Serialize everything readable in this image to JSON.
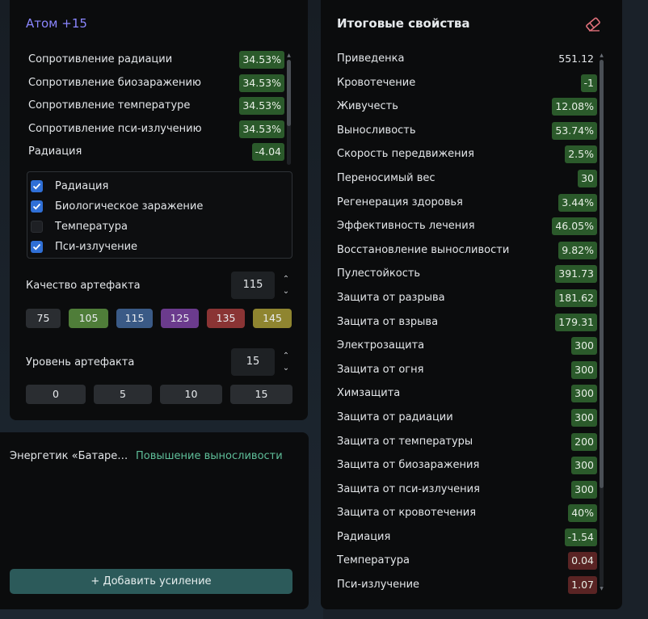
{
  "artifact": {
    "title": "Атом +15",
    "properties": [
      {
        "label": "Сопротивление радиации",
        "value": "34.53%",
        "tone": "green"
      },
      {
        "label": "Сопротивление биозаражению",
        "value": "34.53%",
        "tone": "green"
      },
      {
        "label": "Сопротивление температуре",
        "value": "34.53%",
        "tone": "green"
      },
      {
        "label": "Сопротивление пси-излучению",
        "value": "34.53%",
        "tone": "green"
      },
      {
        "label": "Радиация",
        "value": "-4.04",
        "tone": "green"
      }
    ],
    "filters": [
      {
        "label": "Радиация",
        "checked": true
      },
      {
        "label": "Биологическое заражение",
        "checked": true
      },
      {
        "label": "Температура",
        "checked": false
      },
      {
        "label": "Пси-излучение",
        "checked": true
      }
    ],
    "quality": {
      "label": "Качество артефакта",
      "value": "115",
      "chips": [
        {
          "label": "75",
          "color": "#2a2d31"
        },
        {
          "label": "105",
          "color": "#4f7d39"
        },
        {
          "label": "115",
          "color": "#3a5a86"
        },
        {
          "label": "125",
          "color": "#6b3b8d"
        },
        {
          "label": "135",
          "color": "#8a3434"
        },
        {
          "label": "145",
          "color": "#8f8530"
        }
      ]
    },
    "level": {
      "label": "Уровень артефакта",
      "value": "15",
      "chips": [
        "0",
        "5",
        "10",
        "15"
      ]
    }
  },
  "boost": {
    "name": "Энергетик «Батаре…",
    "effect": "Повышение выносливости",
    "add_label": "+ Добавить усиление"
  },
  "summary": {
    "title": "Итоговые свойства",
    "clear_icon": "eraser-icon",
    "rows": [
      {
        "label": "Приведенка",
        "value": "551.12",
        "tone": "plain"
      },
      {
        "label": "Кровотечение",
        "value": "-1",
        "tone": "green"
      },
      {
        "label": "Живучесть",
        "value": "12.08%",
        "tone": "green"
      },
      {
        "label": "Выносливость",
        "value": "53.74%",
        "tone": "green"
      },
      {
        "label": "Скорость передвижения",
        "value": "2.5%",
        "tone": "green"
      },
      {
        "label": "Переносимый вес",
        "value": "30",
        "tone": "green"
      },
      {
        "label": "Регенерация здоровья",
        "value": "3.44%",
        "tone": "green"
      },
      {
        "label": "Эффективность лечения",
        "value": "46.05%",
        "tone": "green"
      },
      {
        "label": "Восстановление выносливости",
        "value": "9.82%",
        "tone": "green"
      },
      {
        "label": "Пулестойкость",
        "value": "391.73",
        "tone": "green"
      },
      {
        "label": "Защита от разрыва",
        "value": "181.62",
        "tone": "green"
      },
      {
        "label": "Защита от взрыва",
        "value": "179.31",
        "tone": "green"
      },
      {
        "label": "Электрозащита",
        "value": "300",
        "tone": "green"
      },
      {
        "label": "Защита от огня",
        "value": "300",
        "tone": "green"
      },
      {
        "label": "Химзащита",
        "value": "300",
        "tone": "green"
      },
      {
        "label": "Защита от радиации",
        "value": "300",
        "tone": "green"
      },
      {
        "label": "Защита от температуры",
        "value": "200",
        "tone": "green"
      },
      {
        "label": "Защита от биозаражения",
        "value": "300",
        "tone": "green"
      },
      {
        "label": "Защита от пси-излучения",
        "value": "300",
        "tone": "green"
      },
      {
        "label": "Защита от кровотечения",
        "value": "40%",
        "tone": "green"
      },
      {
        "label": "Радиация",
        "value": "-1.54",
        "tone": "green"
      },
      {
        "label": "Температура",
        "value": "0.04",
        "tone": "red"
      },
      {
        "label": "Пси-излучение",
        "value": "1.07",
        "tone": "red"
      }
    ]
  }
}
